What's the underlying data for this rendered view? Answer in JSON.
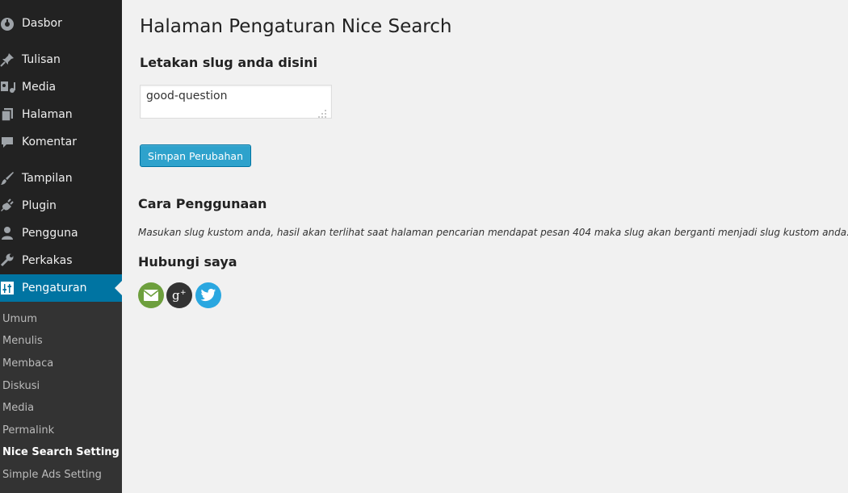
{
  "sidebar": {
    "items": [
      {
        "label": "Dasbor",
        "icon": "dashboard-icon"
      },
      {
        "label": "Tulisan",
        "icon": "pin-icon"
      },
      {
        "label": "Media",
        "icon": "media-icon"
      },
      {
        "label": "Halaman",
        "icon": "pages-icon"
      },
      {
        "label": "Komentar",
        "icon": "comment-icon"
      },
      {
        "label": "Tampilan",
        "icon": "brush-icon"
      },
      {
        "label": "Plugin",
        "icon": "plugin-icon"
      },
      {
        "label": "Pengguna",
        "icon": "user-icon"
      },
      {
        "label": "Perkakas",
        "icon": "wrench-icon"
      },
      {
        "label": "Pengaturan",
        "icon": "settings-icon"
      }
    ],
    "submenu": [
      "Umum",
      "Menulis",
      "Membaca",
      "Diskusi",
      "Media",
      "Permalink",
      "Nice Search Setting",
      "Simple Ads Setting"
    ],
    "active_item": "Pengaturan",
    "current_submenu": "Nice Search Setting"
  },
  "main": {
    "title": "Halaman Pengaturan Nice Search",
    "slug_heading": "Letakan slug anda disini",
    "slug_value": "good-question",
    "save_label": "Simpan Perubahan",
    "usage_heading": "Cara Penggunaan",
    "usage_text": "Masukan slug kustom anda, hasil akan terlihat saat halaman pencarian mendapat pesan 404 maka slug akan berganti menjadi slug kustom anda.",
    "contact_heading": "Hubungi saya",
    "social": [
      {
        "icon": "email-icon",
        "color": "#6d9f3d"
      },
      {
        "icon": "google-plus-icon",
        "color": "#333333"
      },
      {
        "icon": "twitter-icon",
        "color": "#2aa7e0"
      }
    ]
  },
  "colors": {
    "sidebar_bg": "#222222",
    "submenu_bg": "#333333",
    "active_bg": "#0074a2",
    "button_bg": "#2ea2cc",
    "page_bg": "#f1f1f1"
  }
}
